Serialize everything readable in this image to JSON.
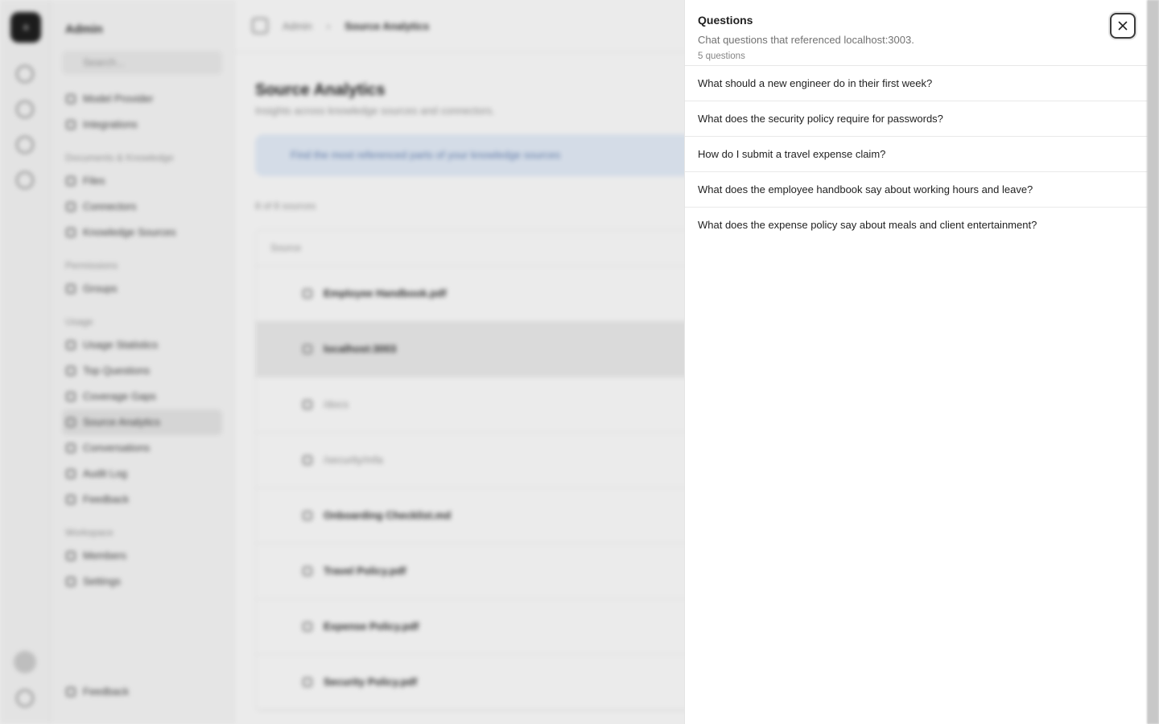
{
  "background": {
    "rail_logo_letter": "a",
    "sidebar": {
      "title": "Admin",
      "search_placeholder": "Search...",
      "groups": [
        {
          "heading": "",
          "items": [
            "Model Provider",
            "Integrations"
          ]
        },
        {
          "heading": "Documents & Knowledge",
          "items": [
            "Files",
            "Connectors",
            "Knowledge Sources"
          ]
        },
        {
          "heading": "Permissions",
          "items": [
            "Groups"
          ]
        },
        {
          "heading": "Usage",
          "items": [
            "Usage Statistics",
            "Top Questions",
            "Coverage Gaps",
            "Source Analytics",
            "Conversations",
            "Audit Log",
            "Feedback"
          ]
        },
        {
          "heading": "Workspace",
          "items": [
            "Members",
            "Settings"
          ]
        }
      ],
      "active_item": "Source Analytics",
      "footer_item": "Feedback"
    },
    "breadcrumb": {
      "root": "Admin",
      "current": "Source Analytics"
    },
    "page_title": "Source Analytics",
    "page_subtitle": "Insights across knowledge sources and connectors.",
    "banner_text": "Find the most referenced parts of your knowledge sources",
    "count_text": "8 of 8 sources",
    "table_header": "Source",
    "rows": [
      {
        "label": "Employee Handbook.pdf",
        "kind": "row"
      },
      {
        "label": "localhost:3003",
        "kind": "selected"
      },
      {
        "label": "/docs",
        "kind": "child"
      },
      {
        "label": "/security/mfa",
        "kind": "child"
      },
      {
        "label": "Onboarding Checklist.md",
        "kind": "row"
      },
      {
        "label": "Travel Policy.pdf",
        "kind": "row"
      },
      {
        "label": "Expense Policy.pdf",
        "kind": "row"
      },
      {
        "label": "Security Policy.pdf",
        "kind": "row"
      }
    ]
  },
  "drawer": {
    "title": "Questions",
    "description": "Chat questions that referenced localhost:3003.",
    "count": "5 questions",
    "close_icon": "close-icon",
    "questions": [
      "What should a new engineer do in their first week?",
      "What does the security policy require for passwords?",
      "How do I submit a travel expense claim?",
      "What does the employee handbook say about working hours and leave?",
      "What does the expense policy say about meals and client entertainment?"
    ]
  }
}
